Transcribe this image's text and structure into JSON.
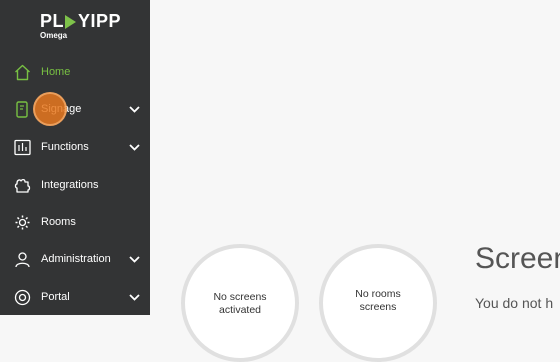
{
  "app": {
    "brand": "PLAYIPP",
    "brand_left": "PL",
    "brand_right": "YIPP",
    "subtitle": "Omega"
  },
  "sidebar": {
    "items": [
      {
        "label": "Home",
        "icon": "home-icon",
        "active": true,
        "expandable": false
      },
      {
        "label": "Signage",
        "icon": "signage-icon",
        "active": false,
        "expandable": true
      },
      {
        "label": "Functions",
        "icon": "functions-icon",
        "active": false,
        "expandable": true
      },
      {
        "label": "Integrations",
        "icon": "integrations-icon",
        "active": false,
        "expandable": false
      },
      {
        "label": "Rooms",
        "icon": "rooms-icon",
        "active": false,
        "expandable": false
      },
      {
        "label": "Administration",
        "icon": "administration-icon",
        "active": false,
        "expandable": true
      },
      {
        "label": "Portal",
        "icon": "portal-icon",
        "active": false,
        "expandable": true
      }
    ]
  },
  "main": {
    "circles": [
      {
        "line1": "No screens",
        "line2": "activated"
      },
      {
        "line1": "No rooms",
        "line2": "screens"
      }
    ],
    "title": "Screen",
    "description": "You do not h"
  },
  "colors": {
    "sidebar_bg": "#333435",
    "accent": "#78c043",
    "click_marker": "#e8781e"
  }
}
